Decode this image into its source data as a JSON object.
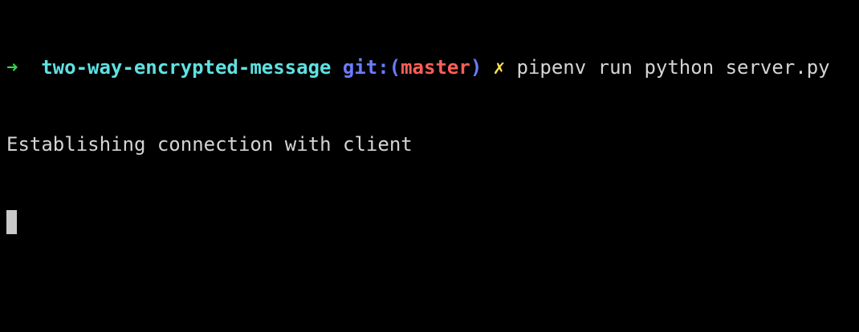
{
  "prompt": {
    "arrow": "➜",
    "directory": "two-way-encrypted-message",
    "git_prefix": "git:(",
    "branch": "master",
    "git_suffix": ")",
    "dirty_marker": "✗",
    "command": "pipenv run python server.py"
  },
  "output": {
    "line1": "Establishing connection with client"
  },
  "colors": {
    "background": "#000000",
    "arrow": "#32d74b",
    "directory": "#5fe1e1",
    "git_label": "#6b7cff",
    "branch": "#ff5f57",
    "dirty": "#ffe45c",
    "text": "#d4d4d4",
    "cursor": "#c9c9c9"
  }
}
